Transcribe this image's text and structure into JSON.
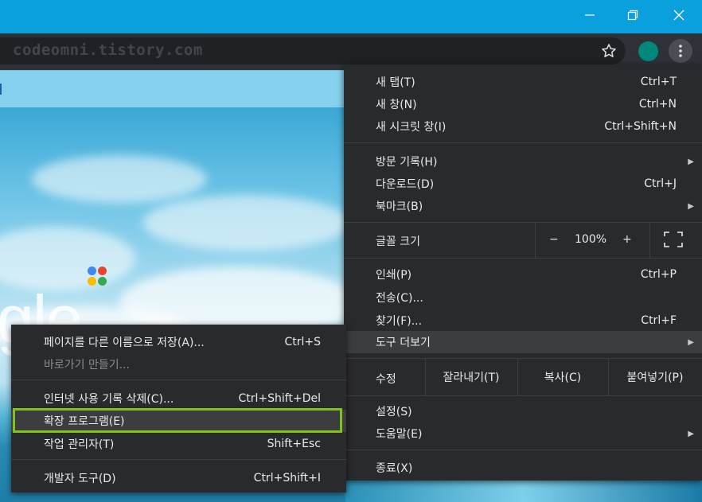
{
  "window": {
    "minimize_icon": "minimize-icon",
    "restore_icon": "restore-icon",
    "close_icon": "close-icon"
  },
  "toolbar": {
    "url": "codeomni.tistory.com",
    "bookmark_icon": "star-icon",
    "extension_color": "#00897b",
    "menu_icon": "kebab-menu-icon"
  },
  "page": {
    "logo_fragment": "gle",
    "apps_dot_colors": [
      "#4285f4",
      "#ea4335",
      "#fbbc05",
      "#34a853"
    ]
  },
  "menu": {
    "new_tab": {
      "label": "새 탭(T)",
      "shortcut": "Ctrl+T"
    },
    "new_window": {
      "label": "새 창(N)",
      "shortcut": "Ctrl+N"
    },
    "new_incognito": {
      "label": "새 시크릿 창(I)",
      "shortcut": "Ctrl+Shift+N"
    },
    "history": {
      "label": "방문 기록(H)"
    },
    "downloads": {
      "label": "다운로드(D)",
      "shortcut": "Ctrl+J"
    },
    "bookmarks": {
      "label": "북마크(B)"
    },
    "zoom": {
      "label": "글꼴 크기",
      "minus": "−",
      "value": "100%",
      "plus": "+",
      "fullscreen_icon": "fullscreen-icon"
    },
    "print": {
      "label": "인쇄(P)",
      "shortcut": "Ctrl+P"
    },
    "cast": {
      "label": "전송(C)..."
    },
    "find": {
      "label": "찾기(F)...",
      "shortcut": "Ctrl+F"
    },
    "more_tools": {
      "label": "도구 더보기"
    },
    "edit": {
      "label": "수정",
      "cut": "잘라내기(T)",
      "copy": "복사(C)",
      "paste": "붙여넣기(P)"
    },
    "settings": {
      "label": "설정(S)"
    },
    "help": {
      "label": "도움말(E)"
    },
    "exit": {
      "label": "종료(X)"
    }
  },
  "submenu": {
    "save_page": {
      "label": "페이지를 다른 이름으로 저장(A)...",
      "shortcut": "Ctrl+S"
    },
    "create_shortcut": {
      "label": "바로가기 만들기..."
    },
    "clear_data": {
      "label": "인터넷 사용 기록 삭제(C)...",
      "shortcut": "Ctrl+Shift+Del"
    },
    "extensions": {
      "label": "확장 프로그램(E)"
    },
    "task_manager": {
      "label": "작업 관리자(T)",
      "shortcut": "Shift+Esc"
    },
    "devtools": {
      "label": "개발자 도구(D)",
      "shortcut": "Ctrl+Shift+I"
    }
  },
  "colors": {
    "title_bar": "#0aa0de",
    "menu_bg": "#292a2d",
    "highlight": "#3c3d41",
    "annotation_box": "#7fc31c"
  }
}
